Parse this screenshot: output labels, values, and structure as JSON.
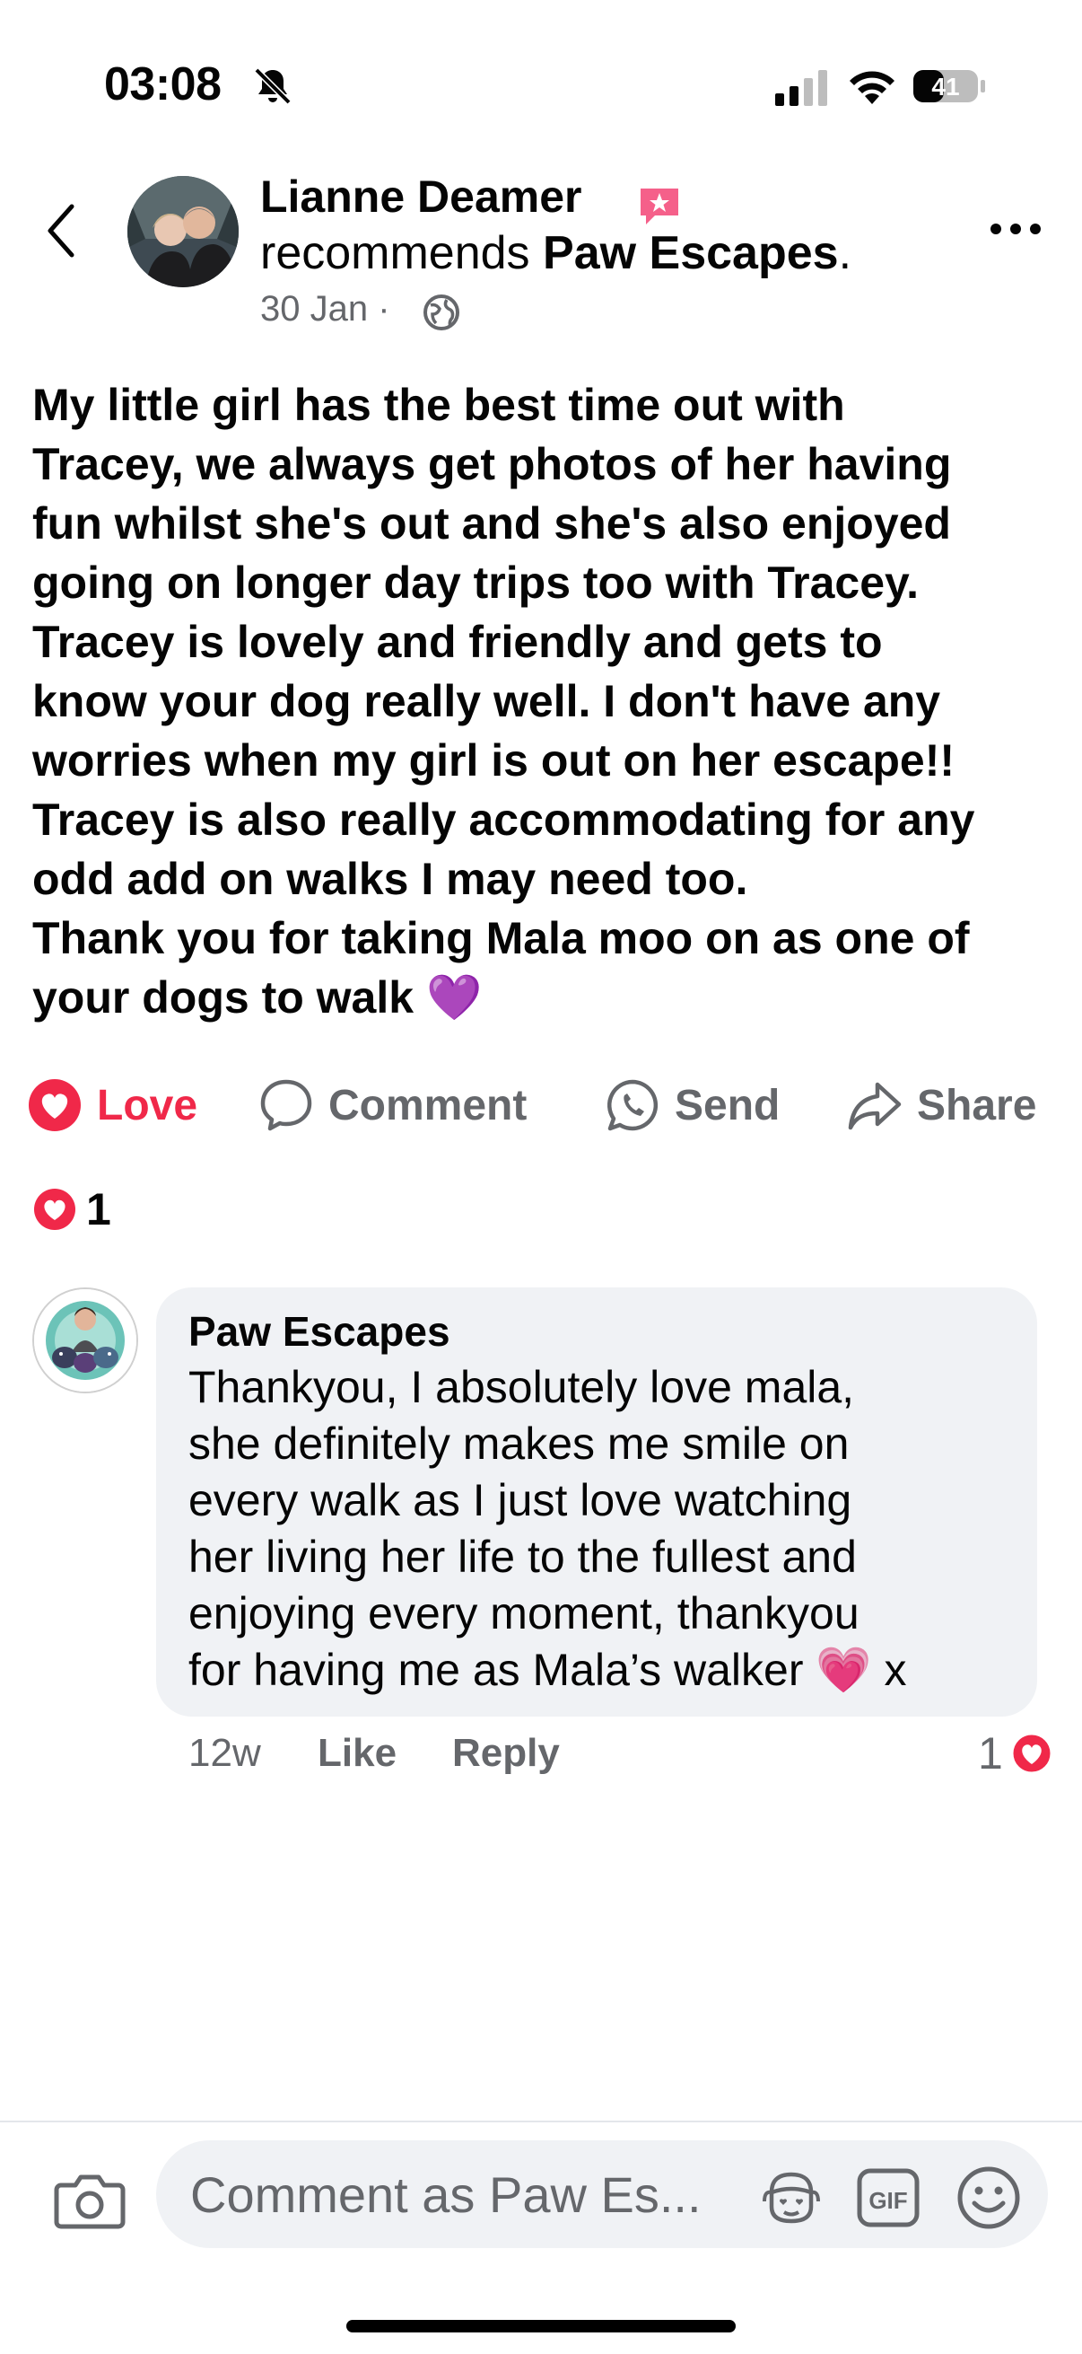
{
  "status_bar": {
    "time": "03:08",
    "battery_level": "41",
    "icons": [
      "bell-slash-icon",
      "signal-icon",
      "wifi-icon",
      "battery-icon"
    ]
  },
  "header": {
    "author_name": "Lianne Deamer",
    "recommends_text": "recommends",
    "page_name": "Paw Escapes",
    "period": ".",
    "date": "30 Jan",
    "separator": "·",
    "icons": [
      "back-chevron-icon",
      "recommendation-badge-icon",
      "globe-icon",
      "more-options-icon"
    ]
  },
  "post": {
    "text": "My little girl has the best time out with\nTracey, we always get photos of her having\nfun whilst she's out and she's also enjoyed\ngoing on longer day trips too with Tracey.\nTracey is lovely and friendly and gets to\nknow your dog really well. I don't have any\nworries when my girl is out on her escape!!\nTracey is also really accommodating for any\nodd add on walks I may need too.\nThank you for taking Mala moo on as one of\nyour dogs to walk 💜"
  },
  "actions": {
    "love": "Love",
    "comment": "Comment",
    "send": "Send",
    "share": "Share"
  },
  "reactions": {
    "count": "1"
  },
  "comment": {
    "author": "Paw Escapes",
    "text": "Thankyou, I absolutely love mala,\nshe definitely makes me smile on\nevery walk as I just love watching\nher living her life to the fullest and\nenjoying every moment, thankyou\nfor having me as Mala’s walker 💗 x",
    "time": "12w",
    "like": "Like",
    "reply": "Reply",
    "reaction_count": "1"
  },
  "composer": {
    "placeholder": "Comment as Paw Es...",
    "icons": [
      "camera-icon",
      "avatar-sticker-icon",
      "gif-icon",
      "emoji-icon"
    ]
  },
  "colors": {
    "love_red": "#f02849",
    "secondary_text": "#65676b",
    "bubble_bg": "#f0f2f5"
  }
}
